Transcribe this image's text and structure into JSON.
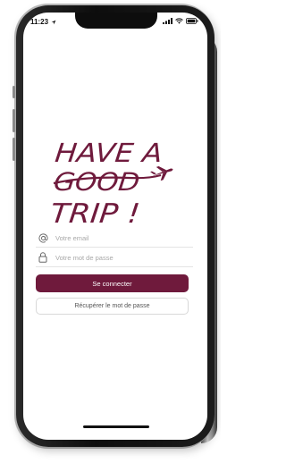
{
  "status_bar": {
    "time": "11:23",
    "location_icon": "location-arrow-icon",
    "signal_icon": "cellular-signal-icon",
    "wifi_icon": "wifi-icon",
    "battery_icon": "battery-icon"
  },
  "logo": {
    "line1": "HAVE A",
    "line2": "GOOD",
    "line3": "TRIP !",
    "color": "#6f1a3c",
    "plane_icon": "airplane-icon"
  },
  "login_form": {
    "email": {
      "icon": "at-sign-icon",
      "placeholder": "Votre email",
      "value": ""
    },
    "password": {
      "icon": "lock-icon",
      "placeholder": "Votre mot de passe",
      "value": ""
    },
    "submit_label": "Se connecter",
    "recover_label": "Récupérer le mot de passe"
  },
  "colors": {
    "brand": "#6f1a3c",
    "background": "#ffffff"
  }
}
